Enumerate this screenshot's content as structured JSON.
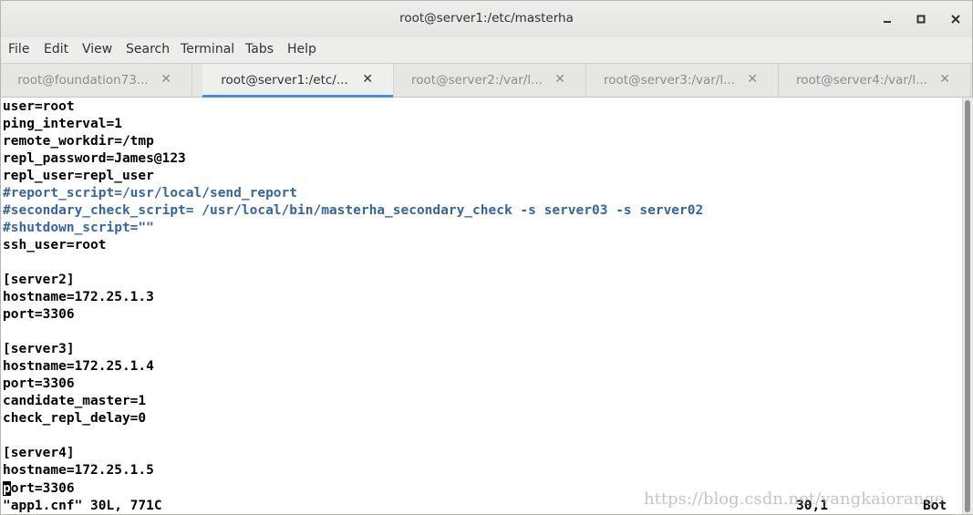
{
  "window": {
    "title": "root@server1:/etc/masterha",
    "minimize_icon": "minimize-icon",
    "maximize_icon": "maximize-icon",
    "close_icon": "close-icon"
  },
  "menu": [
    "File",
    "Edit",
    "View",
    "Search",
    "Terminal",
    "Tabs",
    "Help"
  ],
  "tabs": [
    {
      "label": "root@foundation73...",
      "close": "✕",
      "active": false
    },
    {
      "label": "root@server1:/etc/...",
      "close": "✕",
      "active": true
    },
    {
      "label": "root@server2:/var/l...",
      "close": "✕",
      "active": false
    },
    {
      "label": "root@server3:/var/l...",
      "close": "✕",
      "active": false
    },
    {
      "label": "root@server4:/var/l...",
      "close": "✕",
      "active": false
    }
  ],
  "terminal": {
    "lines": [
      {
        "text": "user=root",
        "comment": false
      },
      {
        "text": "ping_interval=1",
        "comment": false
      },
      {
        "text": "remote_workdir=/tmp",
        "comment": false
      },
      {
        "text": "repl_password=James@123",
        "comment": false
      },
      {
        "text": "repl_user=repl_user",
        "comment": false
      },
      {
        "text": "#report_script=/usr/local/send_report",
        "comment": true
      },
      {
        "text": "#secondary_check_script= /usr/local/bin/masterha_secondary_check -s server03 -s server02",
        "comment": true
      },
      {
        "text": "#shutdown_script=\"\"",
        "comment": true
      },
      {
        "text": "ssh_user=root",
        "comment": false
      },
      {
        "text": "",
        "comment": false
      },
      {
        "text": "[server2]",
        "comment": false
      },
      {
        "text": "hostname=172.25.1.3",
        "comment": false
      },
      {
        "text": "port=3306",
        "comment": false
      },
      {
        "text": "",
        "comment": false
      },
      {
        "text": "[server3]",
        "comment": false
      },
      {
        "text": "hostname=172.25.1.4",
        "comment": false
      },
      {
        "text": "port=3306",
        "comment": false
      },
      {
        "text": "candidate_master=1",
        "comment": false
      },
      {
        "text": "check_repl_delay=0",
        "comment": false
      },
      {
        "text": "",
        "comment": false
      },
      {
        "text": "[server4]",
        "comment": false
      },
      {
        "text": "hostname=172.25.1.5",
        "comment": false
      }
    ],
    "cursor_line": {
      "cursor_char": "p",
      "rest": "ort=3306"
    },
    "status": {
      "file": "\"app1.cnf\" 30L, 771C",
      "position": "30,1",
      "scroll": "Bot"
    },
    "watermark": "https://blog.csdn.net/yangkaiorange",
    "colors": {
      "text": "#000000",
      "comment": "#3465a4",
      "background": "#ffffff"
    }
  }
}
